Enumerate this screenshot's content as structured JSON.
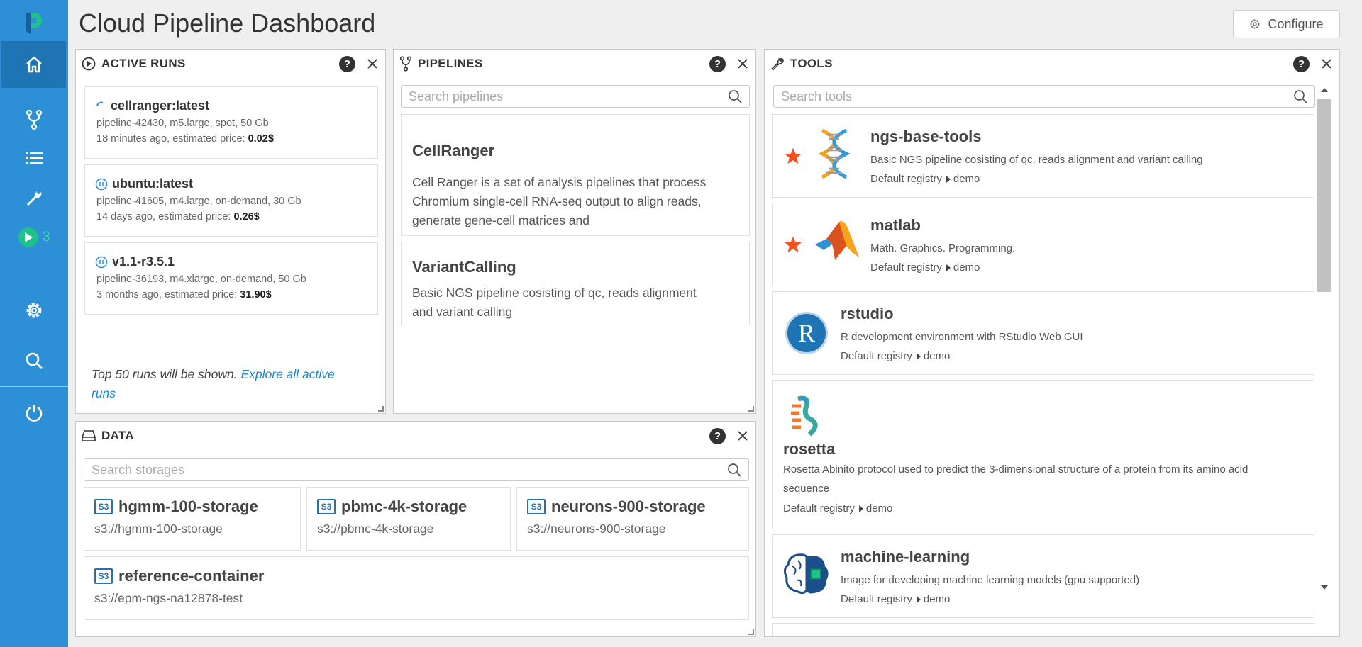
{
  "page": {
    "title": "Cloud Pipeline Dashboard",
    "configure_label": "Configure"
  },
  "sidebar": {
    "active_runs_count": "3"
  },
  "active_runs": {
    "title": "ACTIVE RUNS",
    "help": "?",
    "runs": [
      {
        "name": "cellranger:latest",
        "details": "pipeline-42430, m5.large, spot, 50 Gb",
        "time_prefix": "18 minutes ago, estimated price:",
        "price": "0.02$",
        "status": "initializing"
      },
      {
        "name": "ubuntu:latest",
        "details": "pipeline-41605, m4.large, on-demand, 30 Gb",
        "time_prefix": "14 days ago, estimated price:",
        "price": "0.26$",
        "status": "paused"
      },
      {
        "name": "v1.1-r3.5.1",
        "details": "pipeline-36193, m4.xlarge, on-demand, 50 Gb",
        "time_prefix": "3 months ago, estimated price:",
        "price": "31.90$",
        "status": "paused"
      }
    ],
    "footer_text": "Top 50 runs will be shown.",
    "footer_link": "Explore all active runs"
  },
  "pipelines": {
    "title": "PIPELINES",
    "help": "?",
    "search_placeholder": "Search pipelines",
    "items": [
      {
        "name": "CellRanger",
        "description": "Cell Ranger is a set of analysis pipelines that process Chromium single-cell RNA-seq output to align reads, generate gene-cell matrices and"
      },
      {
        "name": "VariantCalling",
        "description": "Basic NGS pipeline cosisting of qc, reads alignment and variant calling"
      }
    ]
  },
  "tools": {
    "title": "TOOLS",
    "help": "?",
    "search_placeholder": "Search tools",
    "items": [
      {
        "name": "ngs-base-tools",
        "description": "Basic NGS pipeline cosisting of qc, reads alignment and variant calling",
        "registry": "Default registry",
        "group": "demo",
        "starred": true,
        "icon": "dna-icon"
      },
      {
        "name": "matlab",
        "description": "Math. Graphics. Programming.",
        "registry": "Default registry",
        "group": "demo",
        "starred": true,
        "icon": "matlab-logo-icon"
      },
      {
        "name": "rstudio",
        "description": "R development environment with RStudio Web GUI",
        "registry": "Default registry",
        "group": "demo",
        "starred": false,
        "icon": "rstudio-logo-icon",
        "logo_letter": "R"
      },
      {
        "name": "rosetta",
        "description": "Rosetta Abinito protocol used to predict the 3-dimensional structure of a protein from its amino acid sequence",
        "registry": "Default registry",
        "group": "demo",
        "starred": false,
        "icon": "protein-structure-icon"
      },
      {
        "name": "machine-learning",
        "description": "Image for developing machine learning models (gpu supported)",
        "registry": "Default registry",
        "group": "demo",
        "starred": false,
        "icon": "brain-chip-icon"
      }
    ]
  },
  "data": {
    "title": "DATA",
    "help": "?",
    "search_placeholder": "Search storages",
    "badge": "S3",
    "storages": [
      {
        "name": "hgmm-100-storage",
        "path": "s3://hgmm-100-storage"
      },
      {
        "name": "pbmc-4k-storage",
        "path": "s3://pbmc-4k-storage"
      },
      {
        "name": "neurons-900-storage",
        "path": "s3://neurons-900-storage"
      },
      {
        "name": "reference-container",
        "path": "s3://epm-ngs-na12878-test"
      }
    ]
  },
  "colors": {
    "sidebar": "#2d8fd5",
    "sidebar_active": "#1f74b4",
    "link": "#1789d3",
    "star": "#f4511e",
    "run_badge": "#1fc18a"
  }
}
